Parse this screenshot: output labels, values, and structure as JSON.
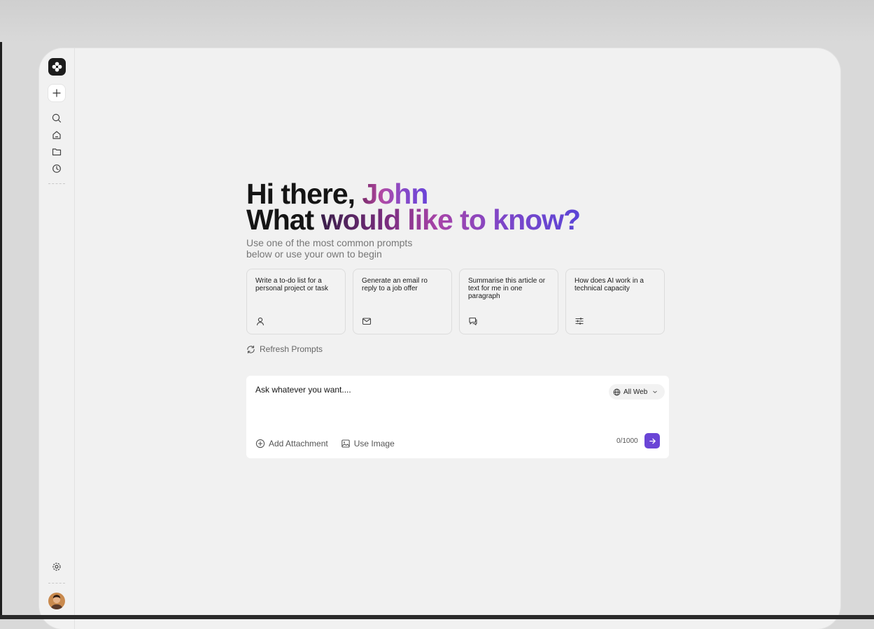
{
  "greeting": {
    "line1_prefix": "Hi there, ",
    "line1_name": "John",
    "line2_word1": "What ",
    "line2_rest": "would like to know?"
  },
  "subtitle": "Use one of the most common prompts below or use your own to begin",
  "cards": [
    {
      "text": "Write a to-do list for a personal project or task",
      "icon": "user-icon"
    },
    {
      "text": "Generate an email ro reply to a job offer",
      "icon": "mail-icon"
    },
    {
      "text": "Summarise this article or text for me in one paragraph",
      "icon": "chat-icon"
    },
    {
      "text": "How does AI work in a technical capacity",
      "icon": "sliders-icon"
    }
  ],
  "refresh_label": "Refresh Prompts",
  "input": {
    "placeholder": "Ask whatever you want....",
    "scope_label": "All Web",
    "add_attachment_label": "Add Attachment",
    "use_image_label": "Use Image",
    "counter": "0/1000"
  },
  "colors": {
    "accent": "#6a45d6",
    "greeting_gradient": [
      "#b24aa4",
      "#6a44d8"
    ]
  }
}
